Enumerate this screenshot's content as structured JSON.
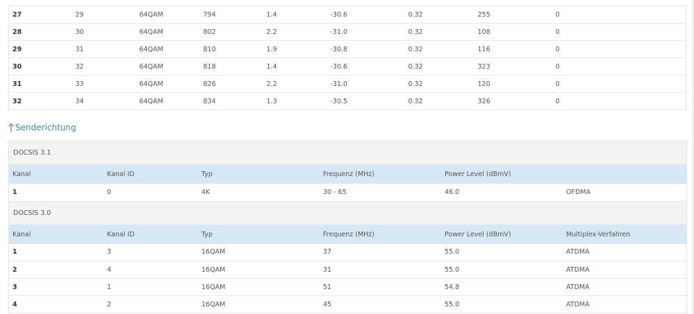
{
  "downstream": {
    "rows": [
      {
        "kanal": "27",
        "kanal_id": "29",
        "typ": "64QAM",
        "frequenz": "794",
        "power": "1.4",
        "mse": "-30.6",
        "latenz": "0.32",
        "korr": "255",
        "nicht_korr": "0"
      },
      {
        "kanal": "28",
        "kanal_id": "30",
        "typ": "64QAM",
        "frequenz": "802",
        "power": "2.2",
        "mse": "-31.0",
        "latenz": "0.32",
        "korr": "108",
        "nicht_korr": "0"
      },
      {
        "kanal": "29",
        "kanal_id": "31",
        "typ": "64QAM",
        "frequenz": "810",
        "power": "1.9",
        "mse": "-30.8",
        "latenz": "0.32",
        "korr": "116",
        "nicht_korr": "0"
      },
      {
        "kanal": "30",
        "kanal_id": "32",
        "typ": "64QAM",
        "frequenz": "818",
        "power": "1.4",
        "mse": "-30.6",
        "latenz": "0.32",
        "korr": "323",
        "nicht_korr": "0"
      },
      {
        "kanal": "31",
        "kanal_id": "33",
        "typ": "64QAM",
        "frequenz": "826",
        "power": "2.2",
        "mse": "-31.0",
        "latenz": "0.32",
        "korr": "120",
        "nicht_korr": "0"
      },
      {
        "kanal": "32",
        "kanal_id": "34",
        "typ": "64QAM",
        "frequenz": "834",
        "power": "1.3",
        "mse": "-30.5",
        "latenz": "0.32",
        "korr": "326",
        "nicht_korr": "0"
      }
    ]
  },
  "upstream": {
    "heading_icon": "arrow-up-icon",
    "heading": "Senderichtung",
    "docsis31": {
      "title": "DOCSIS 3.1",
      "headers": {
        "kanal": "Kanal",
        "kanal_id": "Kanal ID",
        "typ": "Typ",
        "frequenz": "Frequenz (MHz)",
        "power": "Power Level (dBmV)",
        "multiplex": ""
      },
      "rows": [
        {
          "kanal": "1",
          "kanal_id": "0",
          "typ": "4K",
          "frequenz": "30 - 65",
          "power": "46.0",
          "multiplex": "OFDMA"
        }
      ]
    },
    "docsis30": {
      "title": "DOCSIS 3.0",
      "headers": {
        "kanal": "Kanal",
        "kanal_id": "Kanal ID",
        "typ": "Typ",
        "frequenz": "Frequenz (MHz)",
        "power": "Power Level (dBmV)",
        "multiplex": "Multiplex-Verfahren"
      },
      "rows": [
        {
          "kanal": "1",
          "kanal_id": "3",
          "typ": "16QAM",
          "frequenz": "37",
          "power": "55.0",
          "multiplex": "ATDMA"
        },
        {
          "kanal": "2",
          "kanal_id": "4",
          "typ": "16QAM",
          "frequenz": "31",
          "power": "55.0",
          "multiplex": "ATDMA"
        },
        {
          "kanal": "3",
          "kanal_id": "1",
          "typ": "16QAM",
          "frequenz": "51",
          "power": "54.8",
          "multiplex": "ATDMA"
        },
        {
          "kanal": "4",
          "kanal_id": "2",
          "typ": "16QAM",
          "frequenz": "45",
          "power": "55.0",
          "multiplex": "ATDMA"
        }
      ]
    }
  },
  "colors": {
    "accent": "#3d87c4",
    "header_row_bg": "#d6e8f5",
    "group_header_bg": "#f3f3f1"
  }
}
